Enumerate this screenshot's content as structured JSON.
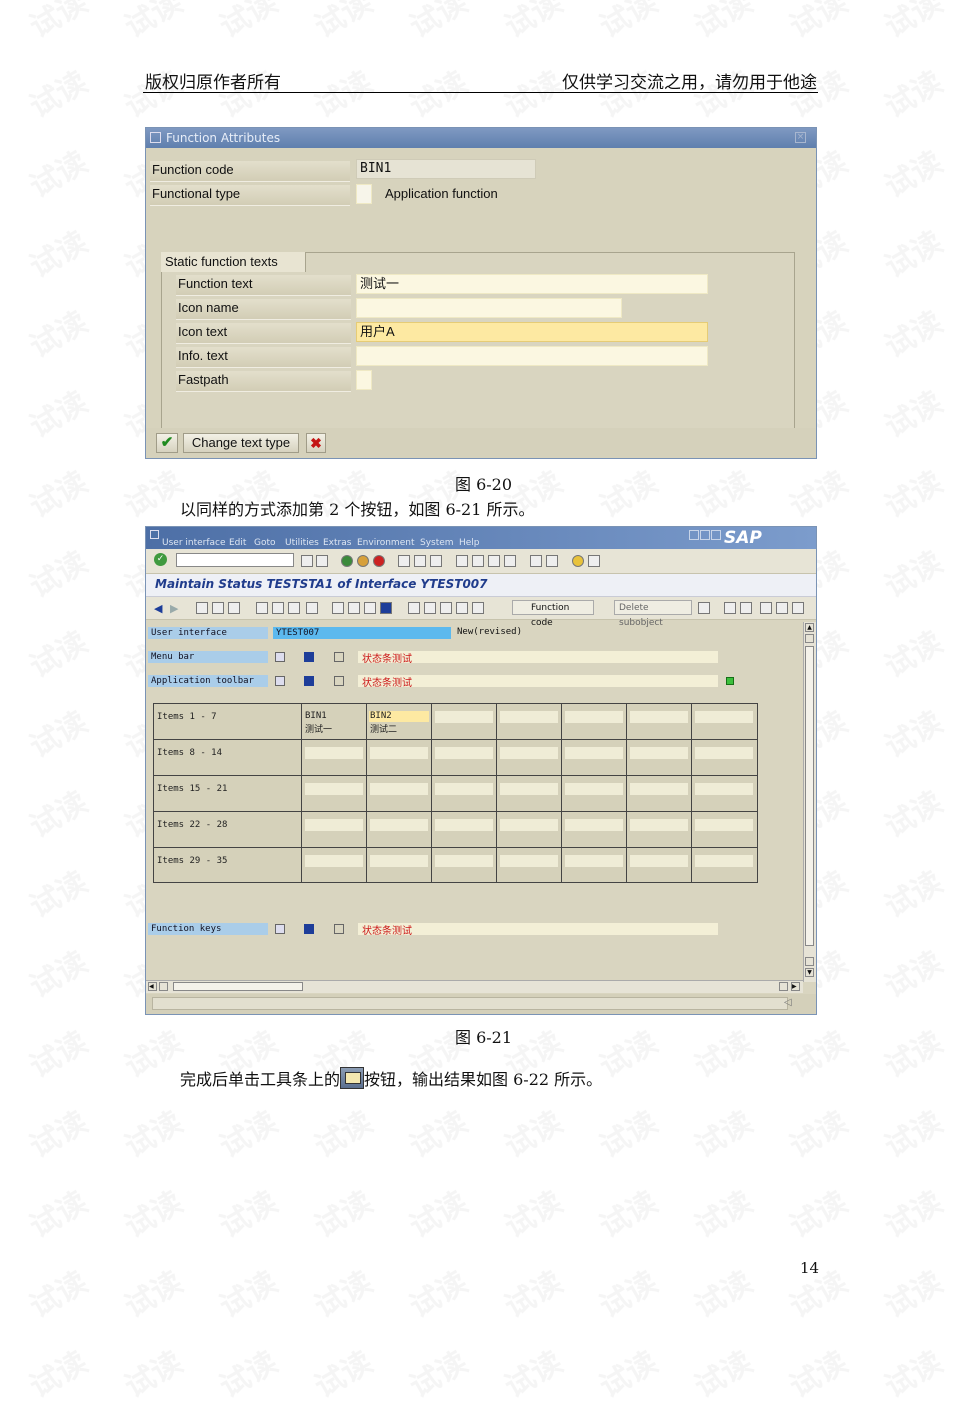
{
  "header": {
    "left": "版权归原作者所有",
    "right": "仅供学习交流之用，请勿用于他途"
  },
  "fig1": {
    "title": "Function Attributes",
    "function_code_label": "Function code",
    "function_code_value": "BIN1",
    "functional_type_label": "Functional type",
    "functional_type_desc": "Application function",
    "group_title": "Static function texts",
    "rows": [
      {
        "label": "Function text",
        "value": "测试一"
      },
      {
        "label": "Icon name",
        "value": ""
      },
      {
        "label": "Icon text",
        "value": "用户A"
      },
      {
        "label": "Info. text",
        "value": ""
      },
      {
        "label": "Fastpath",
        "value": ""
      }
    ],
    "change_text_type_label": "Change text type"
  },
  "caption1": "图 6-20",
  "para1": "以同样的方式添加第 2 个按钮，如图 6-21 所示。",
  "fig2": {
    "menu": [
      "User interface",
      "Edit",
      "Goto",
      "Utilities",
      "Extras",
      "Environment",
      "System",
      "Help"
    ],
    "sap_logo": "SAP",
    "title": "Maintain Status TESTSTA1 of Interface YTEST007",
    "function_code_btn": "Function code",
    "delete_subobject_btn": "Delete subobject",
    "user_interface_label": "User interface",
    "user_interface_value": "YTEST007",
    "user_interface_status": "New(revised)",
    "menu_bar_label": "Menu bar",
    "menu_bar_text": "状态条测试",
    "app_toolbar_label": "Application toolbar",
    "app_toolbar_text": "状态条测试",
    "items": [
      {
        "label": "Items  1 - 7",
        "cells": [
          {
            "code": "BIN1",
            "text": "测试一"
          },
          {
            "code": "BIN2",
            "text": "测试二"
          }
        ]
      },
      {
        "label": "Items  8 - 14",
        "cells": []
      },
      {
        "label": "Items  15 - 21",
        "cells": []
      },
      {
        "label": "Items  22 - 28",
        "cells": []
      },
      {
        "label": "Items  29 - 35",
        "cells": []
      }
    ],
    "function_keys_label": "Function keys",
    "function_keys_text": "状态条测试"
  },
  "caption2": "图 6-21",
  "para2_before": "完成后单击工具条上的",
  "para2_after": "按钮，输出结果如图 6-22 所示。",
  "page_number": "14",
  "watermark": "试读",
  "colors": {
    "sap_blue": "#5f7fae",
    "field_yellow": "#fbf7e1",
    "active_field": "#fde9a2",
    "label_blue": "#aacde9",
    "red_text": "#cc1a1a"
  }
}
